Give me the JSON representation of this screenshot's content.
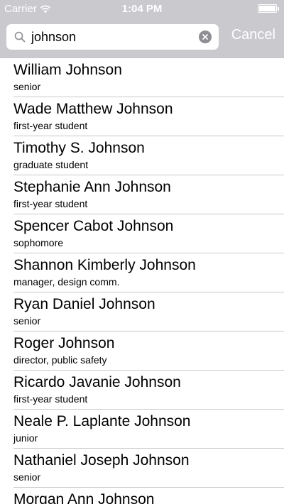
{
  "status_bar": {
    "carrier": "Carrier",
    "time": "1:04 PM",
    "icons": [
      "wifi-icon",
      "battery-icon"
    ]
  },
  "search": {
    "value": "johnson",
    "placeholder": "",
    "cancel_label": "Cancel",
    "icons": [
      "search-icon",
      "clear-icon"
    ]
  },
  "results": [
    {
      "name": "William Johnson",
      "role": "senior"
    },
    {
      "name": "Wade Matthew Johnson",
      "role": "first-year student"
    },
    {
      "name": "Timothy S. Johnson",
      "role": "graduate student"
    },
    {
      "name": "Stephanie Ann Johnson",
      "role": "first-year student"
    },
    {
      "name": "Spencer Cabot Johnson",
      "role": "sophomore"
    },
    {
      "name": "Shannon Kimberly Johnson",
      "role": "manager, design comm."
    },
    {
      "name": "Ryan Daniel Johnson",
      "role": "senior"
    },
    {
      "name": "Roger Johnson",
      "role": "director, public safety"
    },
    {
      "name": "Ricardo Javanie Johnson",
      "role": "first-year student"
    },
    {
      "name": "Neale P. Laplante Johnson",
      "role": "junior"
    },
    {
      "name": "Nathaniel Joseph Johnson",
      "role": "senior"
    },
    {
      "name": "Morgan Ann Johnson",
      "role": ""
    }
  ],
  "colors": {
    "header_background": "#c9c9ce",
    "separator": "#c8c7cc",
    "clear_button": "#8e8e93"
  }
}
